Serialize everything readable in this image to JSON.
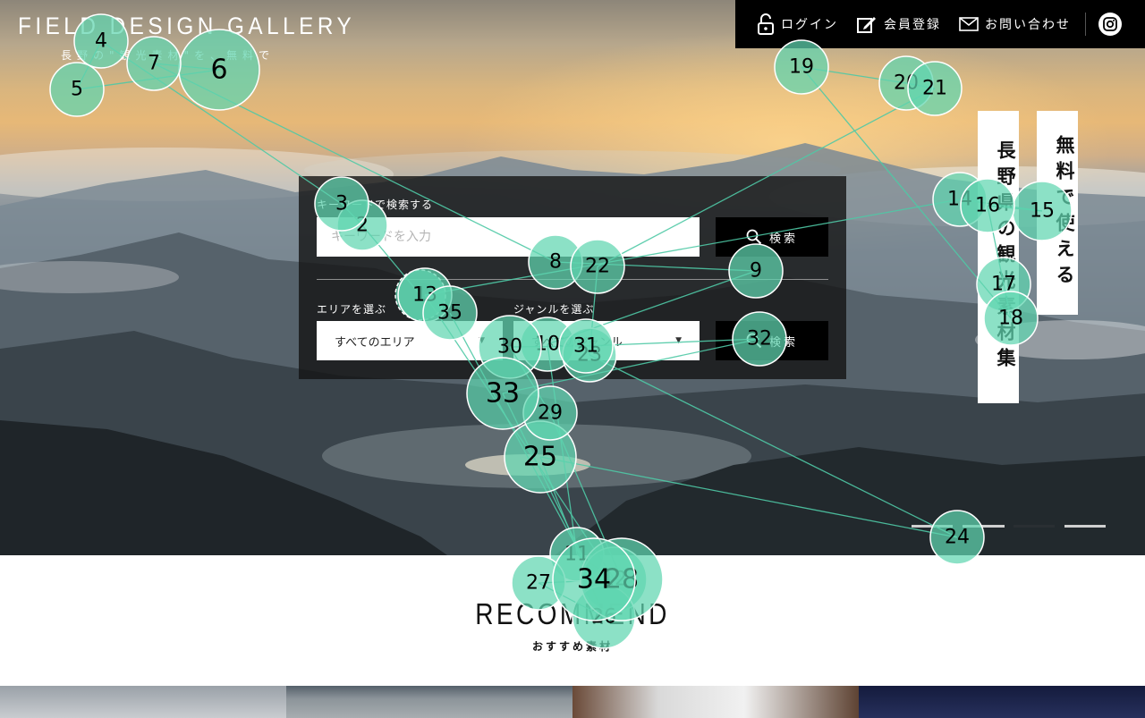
{
  "header": {
    "logo_title": "FIELD DESIGN GALLERY",
    "logo_subtitle": "長野の\"観光素材\"を、無料で",
    "nav": [
      {
        "label": "ログイン",
        "icon": "lock-open-icon"
      },
      {
        "label": "会員登録",
        "icon": "pencil-edit-icon"
      },
      {
        "label": "お問い合わせ",
        "icon": "mail-icon"
      }
    ],
    "social_icon": "instagram-icon"
  },
  "search": {
    "keyword_label": "キーワードで検索する",
    "keyword_placeholder": "キーワードを入力",
    "search_button_label": "検索",
    "area_label": "エリアを選ぶ",
    "area_selected": "すべてのエリア",
    "genre_label": "ジャンルを選ぶ",
    "genre_selected": "すべてのジャンル",
    "filter_button_label": "検索"
  },
  "tagline": {
    "line1": "無料で使える",
    "line2": "長野県の観光素材集"
  },
  "slider": {
    "active_index": 1,
    "count": 3
  },
  "recommend": {
    "title": "RECOMMEND",
    "subtitle": "おすすめ素材"
  },
  "colors": {
    "fixation_fill": "#5fd6b0",
    "fixation_line": "#4fc9a6",
    "panel_bg": "#141414",
    "topbar_bg": "#000000"
  },
  "fixations": [
    {
      "n": 1
    },
    {
      "n": 2
    },
    {
      "n": 3
    },
    {
      "n": 4
    },
    {
      "n": 5
    },
    {
      "n": 6
    },
    {
      "n": 7
    },
    {
      "n": 8
    },
    {
      "n": 9
    },
    {
      "n": 10
    },
    {
      "n": 11
    },
    {
      "n": 12
    },
    {
      "n": 13
    },
    {
      "n": 14
    },
    {
      "n": 15
    },
    {
      "n": 16
    },
    {
      "n": 17
    },
    {
      "n": 18
    },
    {
      "n": 19
    },
    {
      "n": 20
    },
    {
      "n": 21
    },
    {
      "n": 22
    },
    {
      "n": 23
    },
    {
      "n": 24
    },
    {
      "n": 25
    },
    {
      "n": 26
    },
    {
      "n": 27
    },
    {
      "n": 28
    },
    {
      "n": 29
    },
    {
      "n": 30
    },
    {
      "n": 31
    },
    {
      "n": 32
    },
    {
      "n": 33
    },
    {
      "n": 34
    },
    {
      "n": 35
    }
  ]
}
